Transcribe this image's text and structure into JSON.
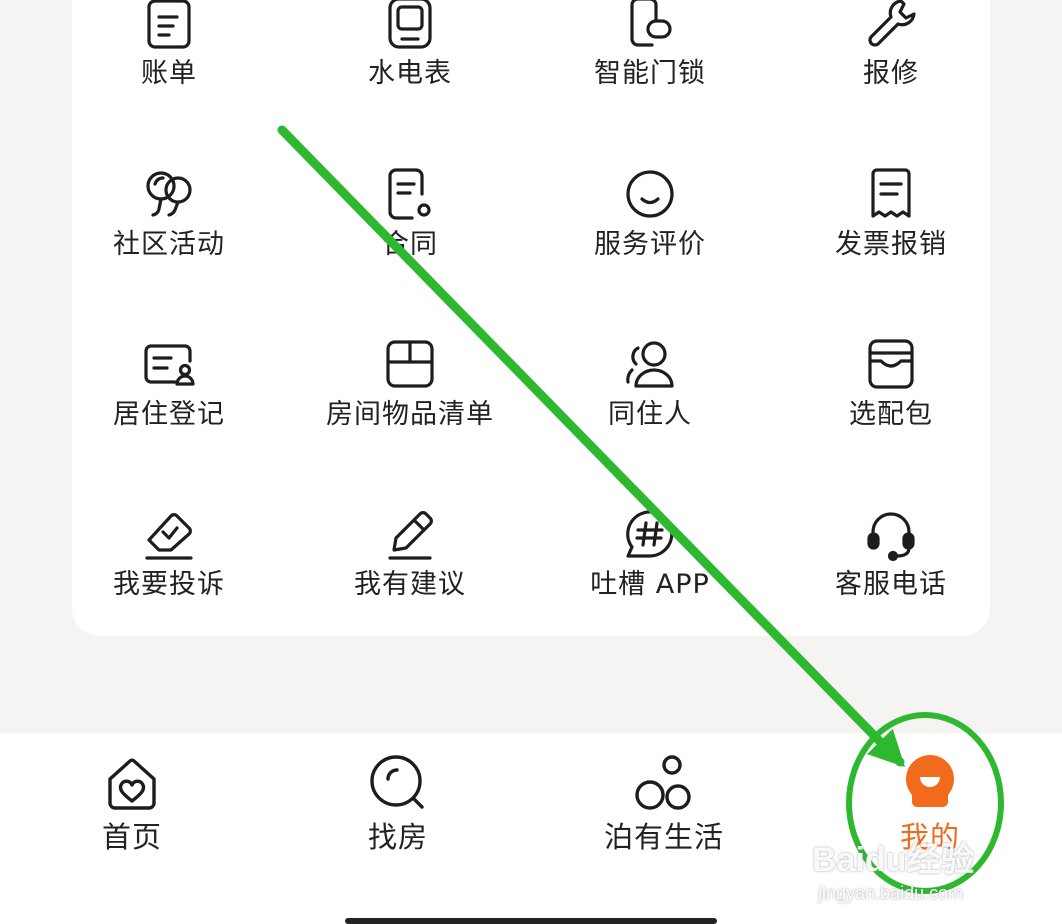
{
  "services": [
    {
      "label": "账单",
      "icon": "bill-icon"
    },
    {
      "label": "水电表",
      "icon": "meter-icon"
    },
    {
      "label": "智能门锁",
      "icon": "smart-lock-icon"
    },
    {
      "label": "报修",
      "icon": "wrench-icon"
    },
    {
      "label": "社区活动",
      "icon": "balloons-icon"
    },
    {
      "label": "合同",
      "icon": "contract-icon"
    },
    {
      "label": "服务评价",
      "icon": "smiley-icon"
    },
    {
      "label": "发票报销",
      "icon": "receipt-icon"
    },
    {
      "label": "居住登记",
      "icon": "id-card-icon"
    },
    {
      "label": "房间物品清单",
      "icon": "box-icon"
    },
    {
      "label": "同住人",
      "icon": "roommates-icon"
    },
    {
      "label": "选配包",
      "icon": "package-icon"
    },
    {
      "label": "我要投诉",
      "icon": "eraser-icon"
    },
    {
      "label": "我有建议",
      "icon": "pencil-icon"
    },
    {
      "label": "吐槽 APP",
      "icon": "hashtag-chat-icon"
    },
    {
      "label": "客服电话",
      "icon": "headset-icon"
    }
  ],
  "tabs": [
    {
      "label": "首页",
      "icon": "home-heart-icon",
      "active": false
    },
    {
      "label": "找房",
      "icon": "search-icon",
      "active": false
    },
    {
      "label": "泊有生活",
      "icon": "bubbles-icon",
      "active": false
    },
    {
      "label": "我的",
      "icon": "profile-icon",
      "active": true
    }
  ],
  "colors": {
    "accent": "#f26a1b",
    "annotation": "#2db82f",
    "text": "#222222",
    "background": "#f5f4f2"
  },
  "watermark": {
    "brand": "Baidu经验",
    "url": "jingyan.baidu.com"
  }
}
